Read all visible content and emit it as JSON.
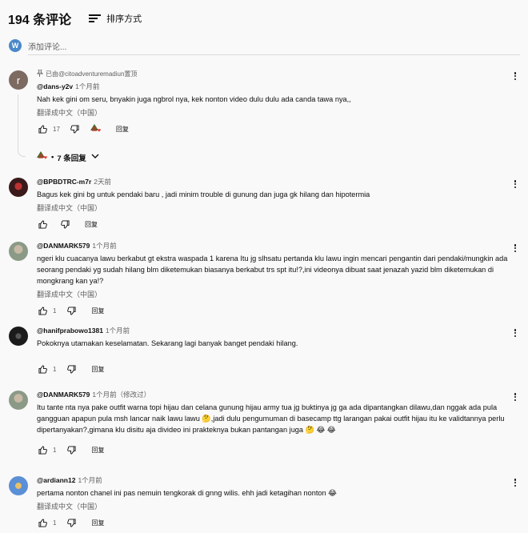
{
  "header": {
    "count": "194 条评论",
    "sort_label": "排序方式"
  },
  "add_comment": {
    "avatar_letter": "W",
    "placeholder": "添加评论..."
  },
  "comments": [
    {
      "pinned": "已由@citoadventuremadiun置顶",
      "author": "@dans-y2v",
      "time": "1个月前",
      "text": "Nah kek gini om seru, bnyakin juga ngbrol nya, kek nonton video dulu dulu ada canda tawa nya,,",
      "translate": "翻译成中文（中国）",
      "likes": "17",
      "reply": "回复",
      "avatar_letter": "r",
      "avatar_color": "#7d6a61",
      "replies_label": "7 条回复"
    },
    {
      "author": "@BPBDTRC-m7r",
      "time": "2天前",
      "text": "Bagus kek gini bg untuk pendaki baru , jadi minim trouble di gunung dan juga gk hilang dan hipotermia",
      "translate": "翻译成中文（中国）",
      "likes": "",
      "reply": "回复",
      "avatar_color": "#3a1a1a"
    },
    {
      "author": "@DANMARK579",
      "time": "1个月前",
      "text": "ngeri klu cuacanya lawu berkabut gt ekstra waspada 1 karena Itu jg slhsatu pertanda klu lawu ingin mencari pengantin dari pendaki/mungkin ada seorang pendaki yg sudah hilang blm diketemukan biasanya berkabut trs spt itu!?,ini videonya dibuat saat jenazah yazid blm diketemukan di mongkrang kan ya!?",
      "translate": "翻译成中文（中国）",
      "likes": "1",
      "reply": "回复",
      "avatar_color": "#8a9a86"
    },
    {
      "author": "@hanifprabowo1381",
      "time": "1个月前",
      "text": "Pokoknya utamakan keselamatan. Sekarang lagi banyak banget pendaki hilang.",
      "translate": "",
      "likes": "1",
      "reply": "回复",
      "avatar_color": "#1b1b1b"
    },
    {
      "author": "@DANMARK579",
      "time": "1个月前（修改过）",
      "text": "Itu tante nta nya pake outfit warna topi hijau dan celana gunung hijau army tua jg buktinya jg ga ada dipantangkan dilawu,dan nggak ada pula gangguan apapun pula msh lancar naik lawu lawu 🤔,jadi dulu pengumuman di basecamp ttg larangan pakai outfit hijau itu ke validtannya perlu dipertanyakan?,gimana klu disitu aja divideo ini prakteknya bukan pantangan juga 🤔 😂 😂",
      "translate": "",
      "likes": "1",
      "reply": "回复",
      "avatar_color": "#8a9a86"
    },
    {
      "author": "@ardiann12",
      "time": "1个月前",
      "text": "pertama nonton chanel ini pas nemuin tengkorak di gnng wilis. ehh jadi ketagihan nonton 😂",
      "translate": "翻译成中文（中国）",
      "likes": "1",
      "reply": "回复",
      "avatar_color": "#5b8fd6"
    }
  ]
}
